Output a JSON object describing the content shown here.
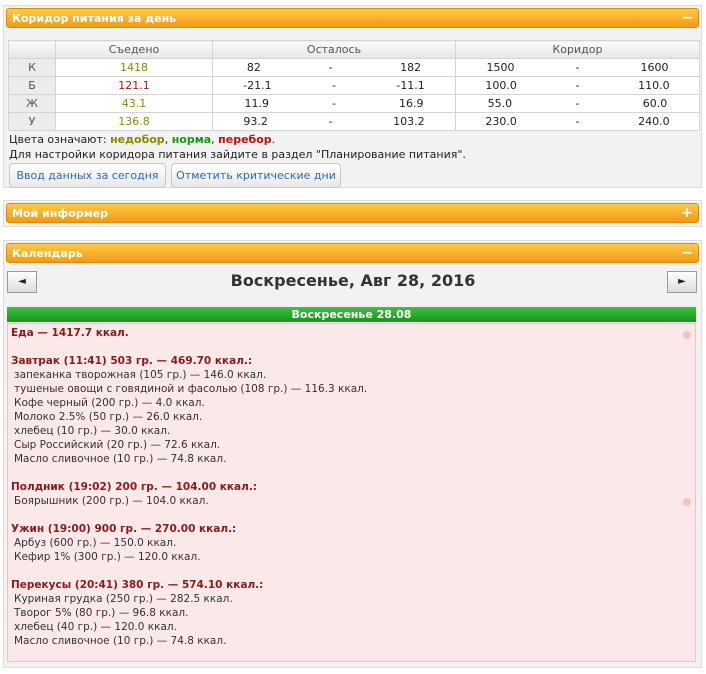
{
  "corridor": {
    "title": "Коридор питания за день",
    "toggle": "−",
    "headers": {
      "eaten": "Съедено",
      "left": "Осталось",
      "corridor": "Коридор"
    },
    "rows": [
      {
        "label": "К",
        "eaten": "1418",
        "status": "under",
        "left_min": "82",
        "left_max": "182",
        "cor_min": "1500",
        "cor_max": "1600"
      },
      {
        "label": "Б",
        "eaten": "121.1",
        "status": "over",
        "left_min": "-21.1",
        "left_max": "-11.1",
        "cor_min": "100.0",
        "cor_max": "110.0"
      },
      {
        "label": "Ж",
        "eaten": "43.1",
        "status": "under",
        "left_min": "11.9",
        "left_max": "16.9",
        "cor_min": "55.0",
        "cor_max": "60.0"
      },
      {
        "label": "У",
        "eaten": "136.8",
        "status": "under",
        "left_min": "93.2",
        "left_max": "103.2",
        "cor_min": "230.0",
        "cor_max": "240.0"
      }
    ],
    "sep": "-",
    "legend": {
      "prefix": "Цвета означают: ",
      "under": "недобор",
      "comma1": ", ",
      "norm": "норма",
      "comma2": ", ",
      "over": "перебор",
      "dot": "."
    },
    "note": "Для настройки коридора питания зайдите в раздел \"Планирование питания\".",
    "btn_today": "Ввод данных за сегодня",
    "btn_critical": "Отметить критические дни"
  },
  "informer": {
    "title": "Мой информер",
    "toggle": "+"
  },
  "calendar": {
    "title": "Календарь",
    "toggle": "−",
    "prev": "◄",
    "next": "►",
    "date": "Воскресенье, Авг 28, 2016",
    "day_header": "Воскресенье 28.08",
    "food_total": "Еда — 1417.7 ккал.",
    "meals": [
      {
        "title": "Завтрак (11:41) 503 гр. — 469.70 ккал.:",
        "items": [
          "запеканка творожная (105 гр.) — 146.0 ккал.",
          "тушеные овощи с говядиной и фасолью (108 гр.) — 116.3 ккал.",
          "Кофе черный (200 гр.) — 4.0 ккал.",
          "Молоко 2.5% (50 гр.) — 26.0 ккал.",
          "хлебец (10 гр.) — 30.0 ккал.",
          "Сыр Российский (20 гр.) — 72.6 ккал.",
          "Масло сливочное (10 гр.) — 74.8 ккал."
        ]
      },
      {
        "title": "Полдник (19:02) 200 гр. — 104.00 ккал.:",
        "items": [
          "Боярышник (200 гр.) — 104.0 ккал."
        ]
      },
      {
        "title": "Ужин (19:00) 900 гр. — 270.00 ккал.:",
        "items": [
          "Арбуз (600 гр.) — 150.0 ккал.",
          "Кефир 1% (300 гр.) — 120.0 ккал."
        ]
      },
      {
        "title": "Перекусы (20:41) 380 гр. — 574.10 ккал.:",
        "items": [
          "Куриная грудка (250 гр.) — 282.5 ккал.",
          "Творог 5% (80 гр.) — 96.8 ккал.",
          "хлебец (40 гр.) — 120.0 ккал.",
          "Масло сливочное (10 гр.) — 74.8 ккал."
        ]
      }
    ]
  }
}
